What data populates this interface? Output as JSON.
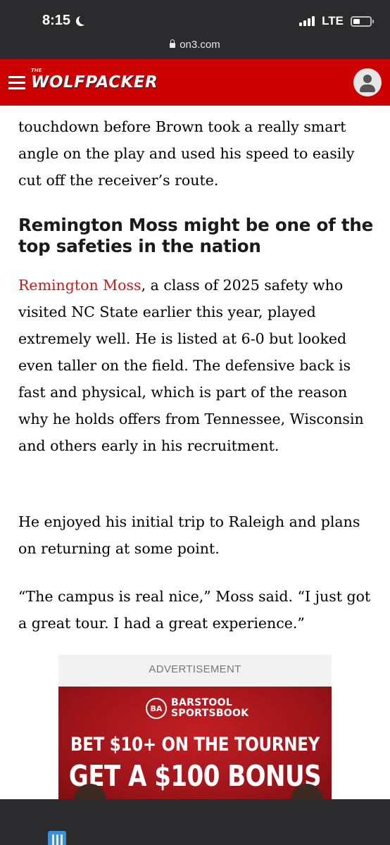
{
  "status_bar": {
    "time": "8:15",
    "network": "LTE",
    "url": "on3.com"
  },
  "site": {
    "logo_small": "THE",
    "logo": "WOLFPACKER"
  },
  "article": {
    "para1": "touchdown before Brown took a really smart angle on the play and used his speed to easily cut off the receiver’s route.",
    "subhead": "Remington Moss might be one of the top safeties in the nation",
    "para2_link": "Remington Moss",
    "para2_rest": ", a class of 2025 safety who visited NC State earlier this year, played extremely well. He is listed at 6-0 but looked even taller on the field. The defensive back is fast and physical, which is part of the reason why he holds offers from Tennessee, Wisconsin and others early in his recruitment.",
    "para3": "He enjoyed his initial trip to Raleigh and plans on returning at some point.",
    "para4": "“The campus is real nice,” Moss said. “I just got a great tour. I had a great experience.”"
  },
  "ad": {
    "label": "ADVERTISEMENT",
    "brand_line1": "BARSTOOL",
    "brand_line2": "SPORTSBOOK",
    "seal": "BA",
    "headline1": "BET $10+ ON THE TOURNEY",
    "headline2": "GET A $100 BONUS"
  },
  "colors": {
    "header_red": "#cc0000",
    "link_red": "#c41c1c",
    "chrome_dark": "#2b2b2d"
  },
  "icons": [
    "moon-icon",
    "signal-icon",
    "battery-icon",
    "lock-icon",
    "hamburger-icon",
    "user-icon"
  ]
}
